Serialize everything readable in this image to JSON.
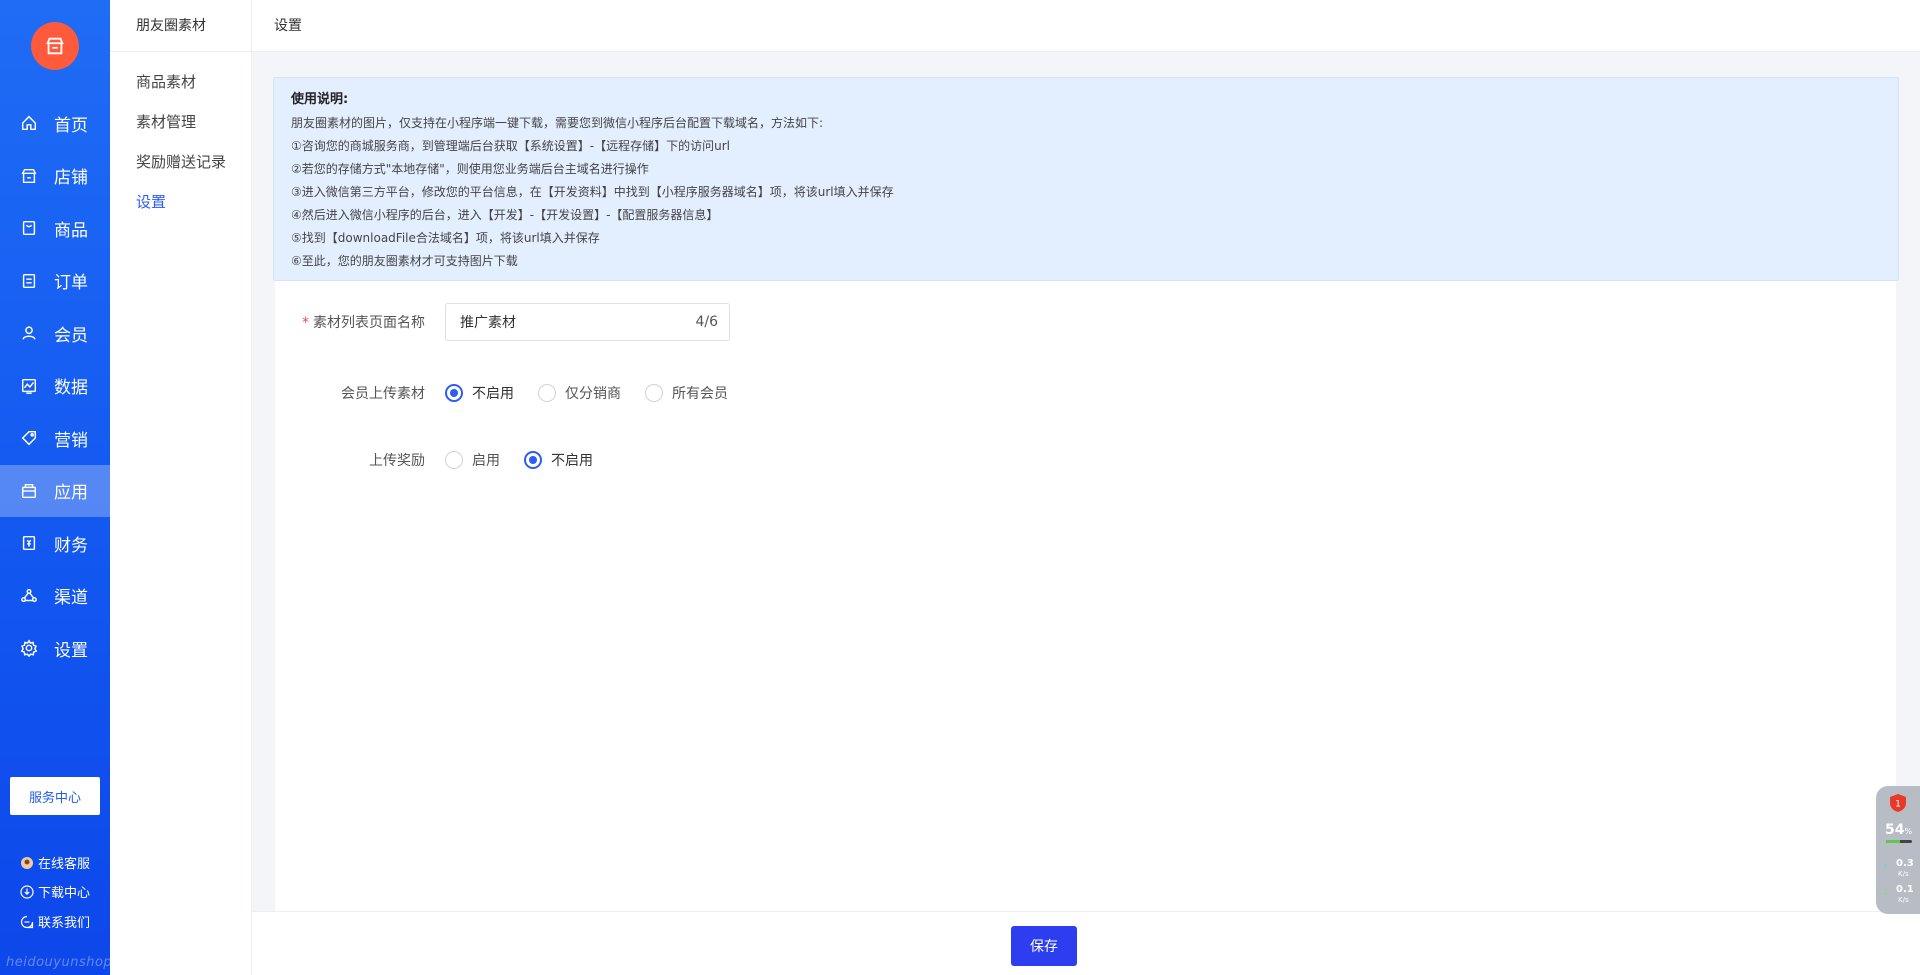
{
  "nav": {
    "items": [
      {
        "label": "首页",
        "icon": "home-icon"
      },
      {
        "label": "店铺",
        "icon": "store-icon"
      },
      {
        "label": "商品",
        "icon": "product-icon"
      },
      {
        "label": "订单",
        "icon": "order-icon"
      },
      {
        "label": "会员",
        "icon": "user-icon"
      },
      {
        "label": "数据",
        "icon": "chart-icon"
      },
      {
        "label": "营销",
        "icon": "tag-icon"
      },
      {
        "label": "应用",
        "icon": "app-icon"
      },
      {
        "label": "财务",
        "icon": "finance-icon"
      },
      {
        "label": "渠道",
        "icon": "channel-icon"
      },
      {
        "label": "设置",
        "icon": "gear-icon"
      }
    ],
    "active_index": 7,
    "service_center": "服务中心",
    "online_service": "在线客服",
    "download_center": "下载中心",
    "contact_us": "联系我们",
    "watermark": "heidouyunshop"
  },
  "subnav": {
    "title": "朋友圈素材",
    "items": [
      "商品素材",
      "素材管理",
      "奖励赠送记录",
      "设置"
    ],
    "active_index": 3
  },
  "header": {
    "title": "设置"
  },
  "notice": {
    "title": "使用说明:",
    "lines": [
      "朋友圈素材的图片，仅支持在小程序端一键下载，需要您到微信小程序后台配置下载域名，方法如下:",
      "①咨询您的商城服务商，到管理端后台获取【系统设置】-【远程存储】下的访问url",
      "②若您的存储方式\"本地存储\"，则使用您业务端后台主域名进行操作",
      "③进入微信第三方平台，修改您的平台信息，在【开发资料】中找到【小程序服务器域名】项，将该url填入并保存",
      "④然后进入微信小程序的后台，进入【开发】-【开发设置】-【配置服务器信息】",
      "⑤找到【downloadFile合法域名】项，将该url填入并保存",
      "⑥至此，您的朋友圈素材才可支持图片下载"
    ]
  },
  "form": {
    "page_name": {
      "label": "素材列表页面名称",
      "required_mark": "*",
      "value": "推广素材",
      "count": "4/6"
    },
    "member_upload": {
      "label": "会员上传素材",
      "options": [
        "不启用",
        "仅分销商",
        "所有会员"
      ],
      "selected": 0
    },
    "upload_reward": {
      "label": "上传奖励",
      "options": [
        "启用",
        "不启用"
      ],
      "selected": 1
    }
  },
  "footer": {
    "save_label": "保存"
  },
  "monitor": {
    "badge": "1",
    "cpu_percent": 54,
    "pct_unit": "%",
    "upload_speed": "0.3",
    "download_speed": "0.1",
    "unit": "K/s"
  },
  "colors": {
    "nav_bg": "#1f6cf5",
    "accent": "#2d5cf6",
    "save_button": "#2d3ef0",
    "logo": "#ff5a3c",
    "notice_bg": "#e3efff"
  }
}
